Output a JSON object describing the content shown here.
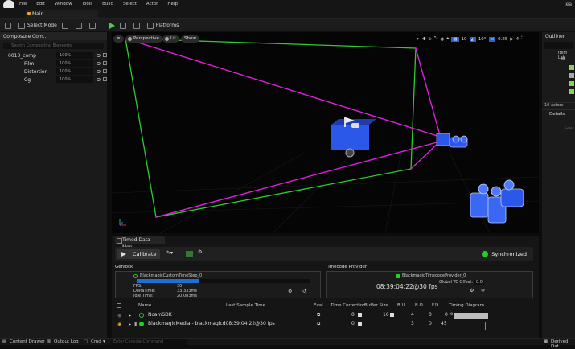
{
  "menu": {
    "items": [
      "File",
      "Edit",
      "Window",
      "Tools",
      "Build",
      "Select",
      "Actor",
      "Help"
    ],
    "right_text": "Tea"
  },
  "tab": {
    "label": "Main"
  },
  "toolbar": {
    "select_mode": "Select Mode",
    "platforms": "Platforms"
  },
  "composure": {
    "title": "Composure Com...",
    "search_placeholder": "Search Compositing Elements",
    "rows": [
      {
        "name": "0010_comp",
        "pct": "100%"
      },
      {
        "name": "Film",
        "pct": "100%"
      },
      {
        "name": "Distortion",
        "pct": "100%"
      },
      {
        "name": "Cg",
        "pct": "100%"
      }
    ]
  },
  "viewport": {
    "perspective": "Perspective",
    "lit": "Lit",
    "show": "Show",
    "snap_grid": "10",
    "snap_angle": "10°",
    "snap_scale": "0.25",
    "camera_speed": "4"
  },
  "outliner": {
    "title": "Outliner",
    "col_label": "Item Lab",
    "row_m": "M",
    "actor_count": "10 actors",
    "details": "Details",
    "select_hint": "Selec"
  },
  "timed_data": {
    "tab_label": "Timed Data Moni...",
    "calibrate": "Calibrate",
    "status": "Synchronized",
    "genlock": {
      "label": "Genlock",
      "source": "BlackmagicCustomTimeStep_0",
      "fps_label": "FPS:",
      "fps": "30",
      "delta_label": "DeltaTime:",
      "delta": "33.333ms",
      "idle_label": "Idle Time:",
      "idle": "20.083ms",
      "bar_fill": 0.36
    },
    "timecode": {
      "label": "Timecode Provider",
      "source": "BlackmagicTimecodeProvider_0",
      "value": "08:39:04:22@30 fps",
      "offset_label": "Global TC Offset:",
      "offset": "0.0"
    },
    "columns": [
      "Name",
      "Last Sample Time",
      "Eval.",
      "Time Correction",
      "Buffer Size",
      "B.U.",
      "B.O.",
      "F.D.",
      "Timing Diagram"
    ],
    "rows": [
      {
        "name": "NcamSDK",
        "last_sample": "",
        "time_correction": "0",
        "buffer_size": "10",
        "bu": "4",
        "bo": "0",
        "fd": "0"
      },
      {
        "name": "BlackmagicMedia - blackmagicd08:39:04:22@30 fps",
        "last_sample": "",
        "time_correction": "0",
        "buffer_size": "",
        "bu": "3",
        "bo": "0",
        "fd": "45"
      }
    ]
  },
  "statusbar": {
    "content_drawer": "Content Drawer",
    "output_log": "Output Log",
    "cmd": "Cmd",
    "console_placeholder": "Enter Console Command",
    "derived": "Derived Dat"
  },
  "colors": {
    "frustum_magenta": "#e01ee0",
    "frustum_green": "#2ecc2e",
    "camera_blue": "#2b58e8",
    "status_green": "#1ed21e",
    "progress_blue": "#1e6fd6"
  }
}
